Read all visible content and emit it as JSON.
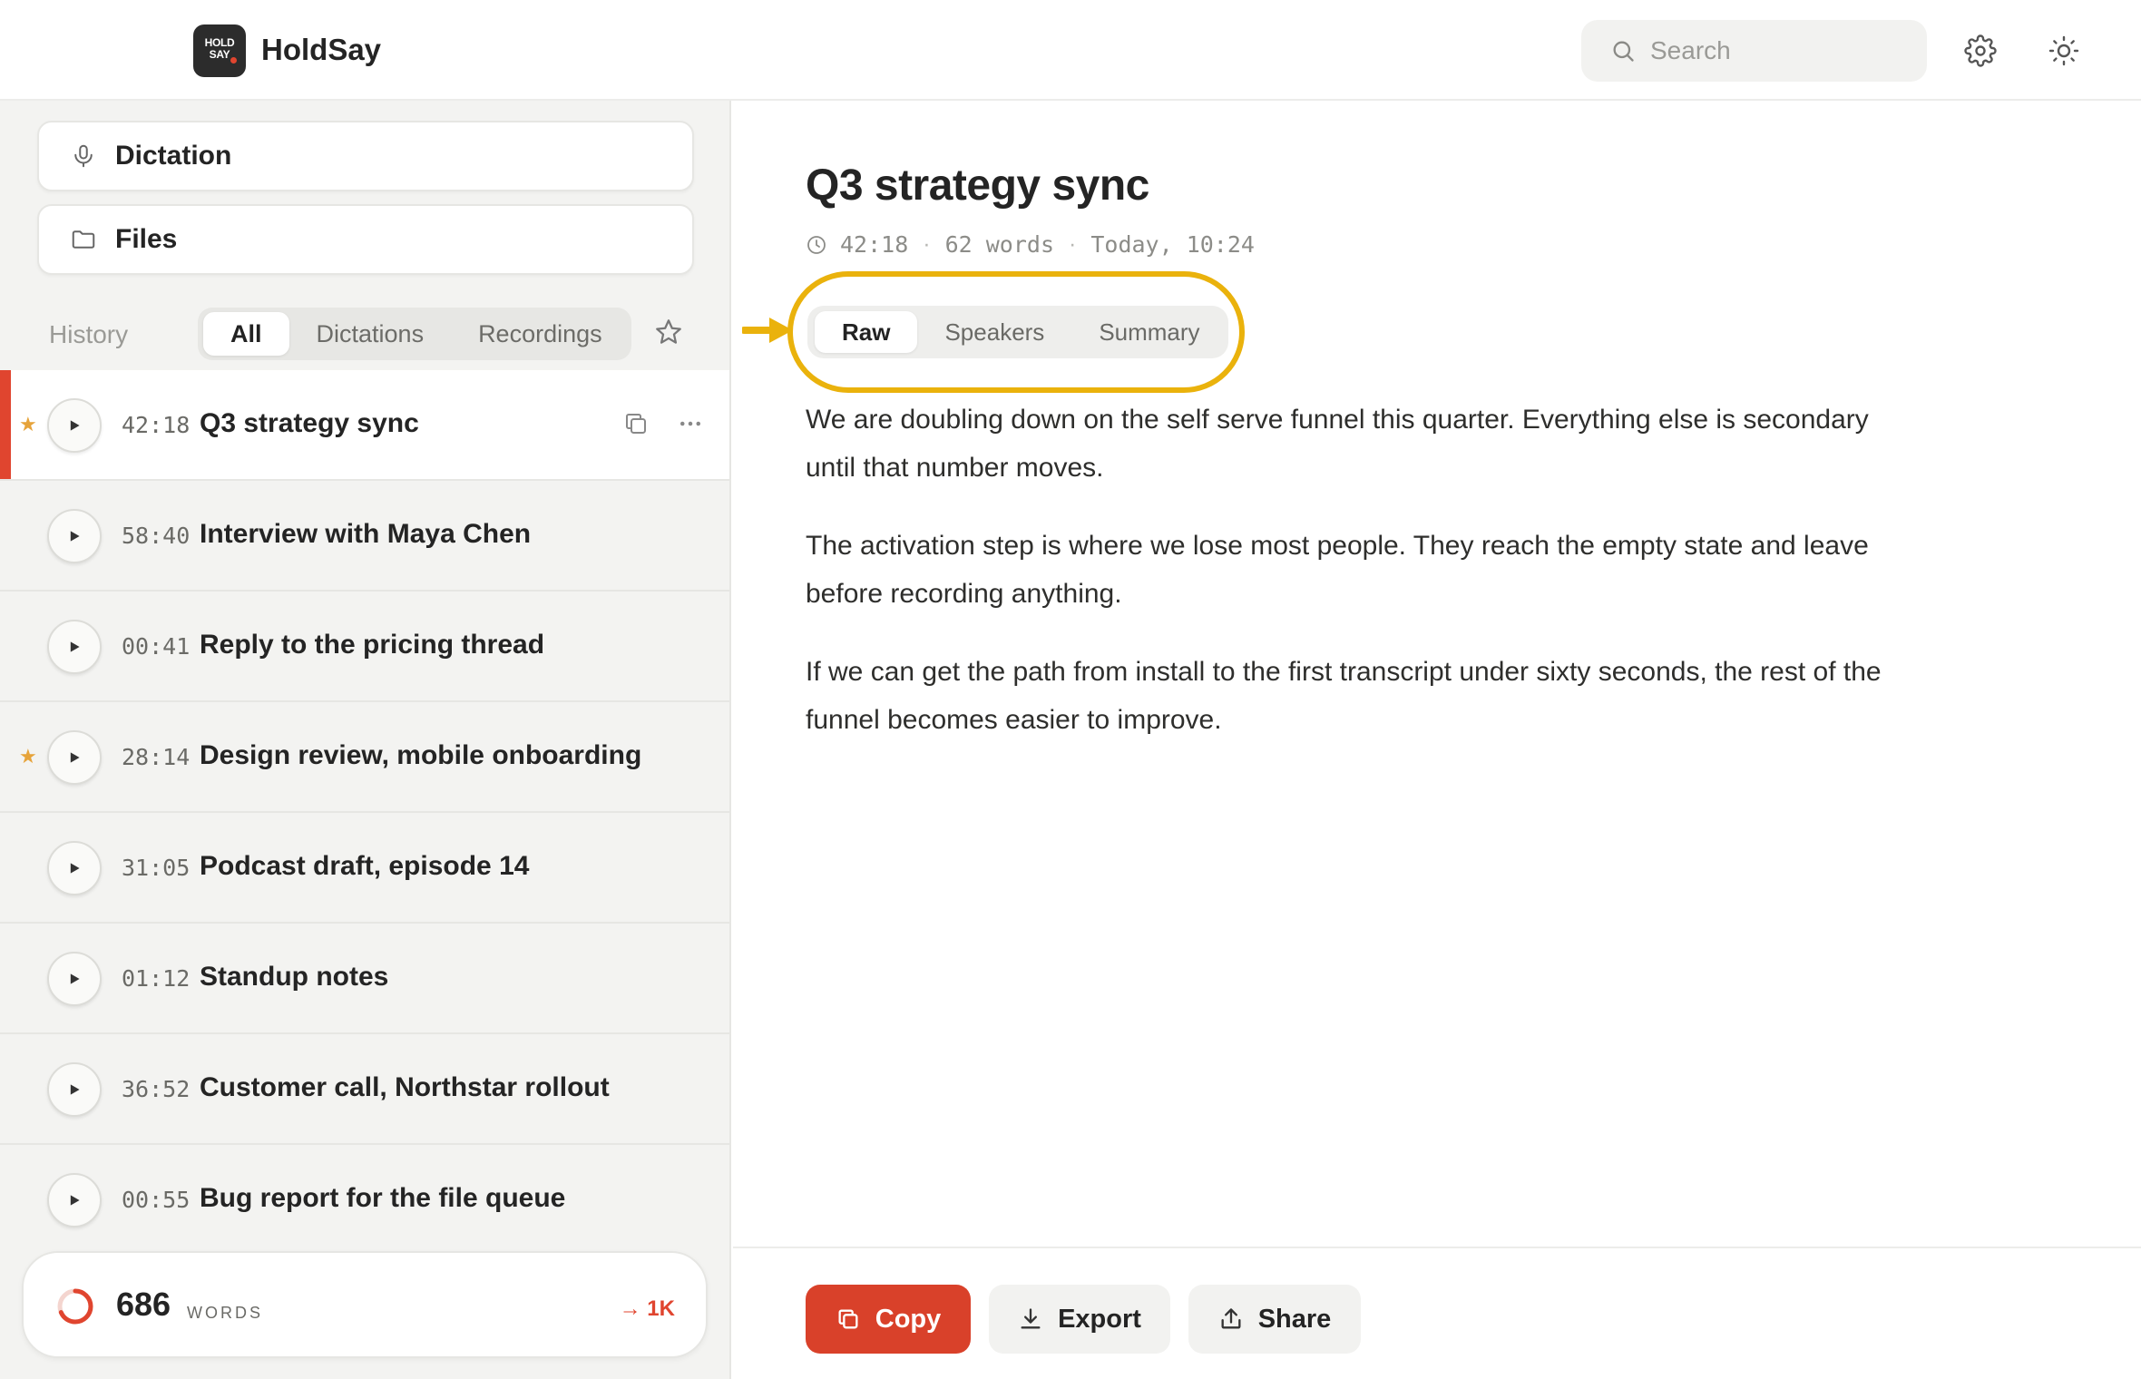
{
  "header": {
    "logo_text_line1": "HOLD",
    "logo_text_line2": "SAY",
    "app_name": "HoldSay",
    "search_placeholder": "Search"
  },
  "sidebar": {
    "nav": [
      {
        "label": "Dictation",
        "icon": "microphone-icon"
      },
      {
        "label": "Files",
        "icon": "folder-icon"
      }
    ],
    "history_label": "History",
    "filters": [
      "All",
      "Dictations",
      "Recordings"
    ],
    "active_filter": "All",
    "items": [
      {
        "duration": "42:18",
        "title": "Q3 strategy sync",
        "starred": true,
        "selected": true
      },
      {
        "duration": "58:40",
        "title": "Interview with Maya Chen",
        "starred": false
      },
      {
        "duration": "00:41",
        "title": "Reply to the pricing thread",
        "starred": false
      },
      {
        "duration": "28:14",
        "title": "Design review, mobile onboarding",
        "starred": true
      },
      {
        "duration": "31:05",
        "title": "Podcast draft, episode 14",
        "starred": false
      },
      {
        "duration": "01:12",
        "title": "Standup notes",
        "starred": false
      },
      {
        "duration": "36:52",
        "title": "Customer call, Northstar rollout",
        "starred": false
      },
      {
        "duration": "00:55",
        "title": "Bug report for the file queue",
        "starred": false
      }
    ],
    "stats": {
      "count": "686",
      "unit": "WORDS",
      "goal": "→ 1K",
      "progress": 0.686
    }
  },
  "main": {
    "title": "Q3 strategy sync",
    "meta": {
      "duration": "42:18",
      "words": "62 words",
      "date": "Today, 10:24"
    },
    "tabs": [
      "Raw",
      "Speakers",
      "Summary"
    ],
    "active_tab": "Raw",
    "paragraphs": [
      "We are doubling down on the self serve funnel this quarter. Everything else is secondary until that number moves.",
      "The activation step is where we lose most people. They reach the empty state and leave before recording anything.",
      "If we can get the path from install to the first transcript under sixty seconds, the rest of the funnel becomes easier to improve."
    ],
    "actions": {
      "copy": "Copy",
      "export": "Export",
      "share": "Share"
    }
  },
  "colors": {
    "accent": "#d9412a",
    "highlight": "#eab20c",
    "star": "#e6a33a"
  }
}
